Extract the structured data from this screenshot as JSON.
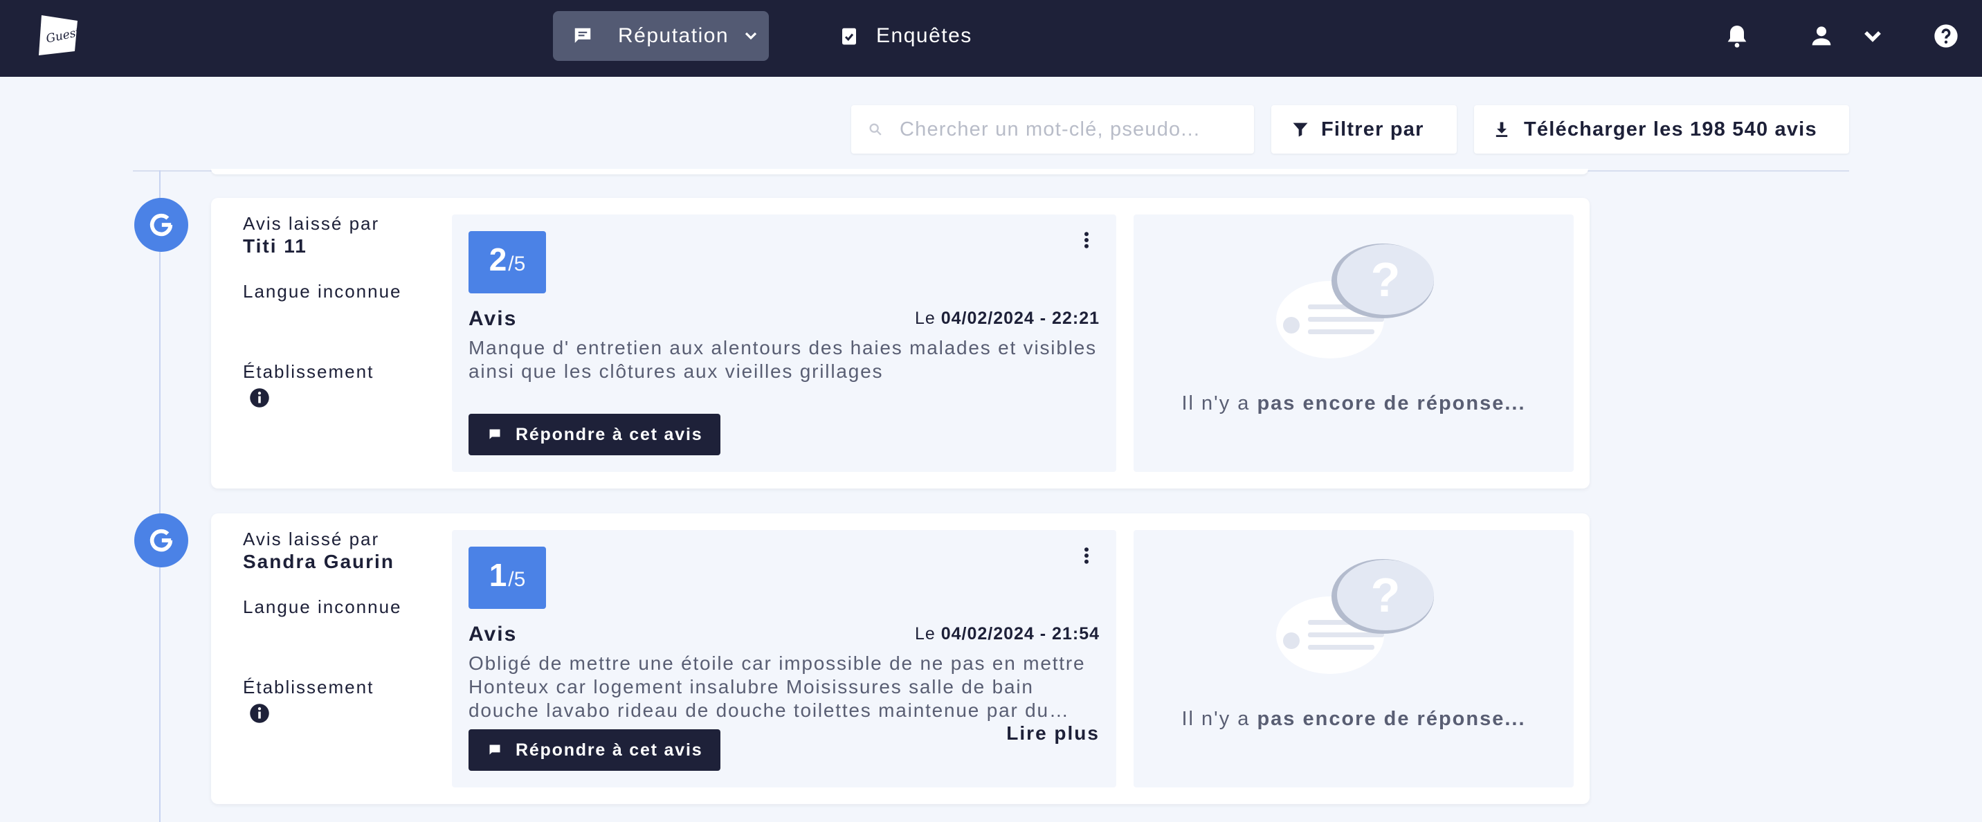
{
  "brand": {
    "name": "Guest Suite",
    "logo_text": "Guest",
    "nav_bg": "#1e2139",
    "accent": "#4b82e6"
  },
  "nav": {
    "items": [
      {
        "label": "Réputation",
        "icon": "comment-icon",
        "active": true,
        "has_dropdown": true
      },
      {
        "label": "Enquêtes",
        "icon": "clipboard-check-icon",
        "active": false,
        "has_dropdown": false
      }
    ],
    "right_icons": [
      "bell-icon",
      "user-icon",
      "chevron-down-icon",
      "help-icon"
    ]
  },
  "toolbar": {
    "search_placeholder": "Chercher un mot-clé, pseudo...",
    "filter_label": "Filtrer par",
    "download_label": "Télécharger les 198 540 avis"
  },
  "reviews": [
    {
      "source_icon": "google-icon",
      "left_by_label": "Avis laissé par",
      "author": "Titi 11",
      "language": "Langue inconnue",
      "establishment_label": "Établissement",
      "score": "2",
      "max": "/5",
      "title": "Avis",
      "date_prefix": "Le",
      "date": "04/02/2024 - 22:21",
      "text": "Manque d' entretien aux alentours des haies malades et visibles ainsi que les clôtures aux vieilles grillages",
      "read_more": "",
      "reply_label": "Répondre à cet avis",
      "no_answer_prefix": "Il n'y a",
      "no_answer_bold": "pas encore de réponse..."
    },
    {
      "source_icon": "google-icon",
      "left_by_label": "Avis laissé par",
      "author": "Sandra Gaurin",
      "language": "Langue inconnue",
      "establishment_label": "Établissement",
      "score": "1",
      "max": "/5",
      "title": "Avis",
      "date_prefix": "Le",
      "date": "04/02/2024 - 21:54",
      "text": "Obligé de mettre une étoile car impossible de ne pas en mettre Honteux car logement insalubre Moisissures salle de bain douche lavabo rideau de douche toilettes maintenue par du scotch",
      "read_more": "Lire plus",
      "reply_label": "Répondre à cet avis",
      "no_answer_prefix": "Il n'y a",
      "no_answer_bold": "pas encore de réponse..."
    }
  ]
}
